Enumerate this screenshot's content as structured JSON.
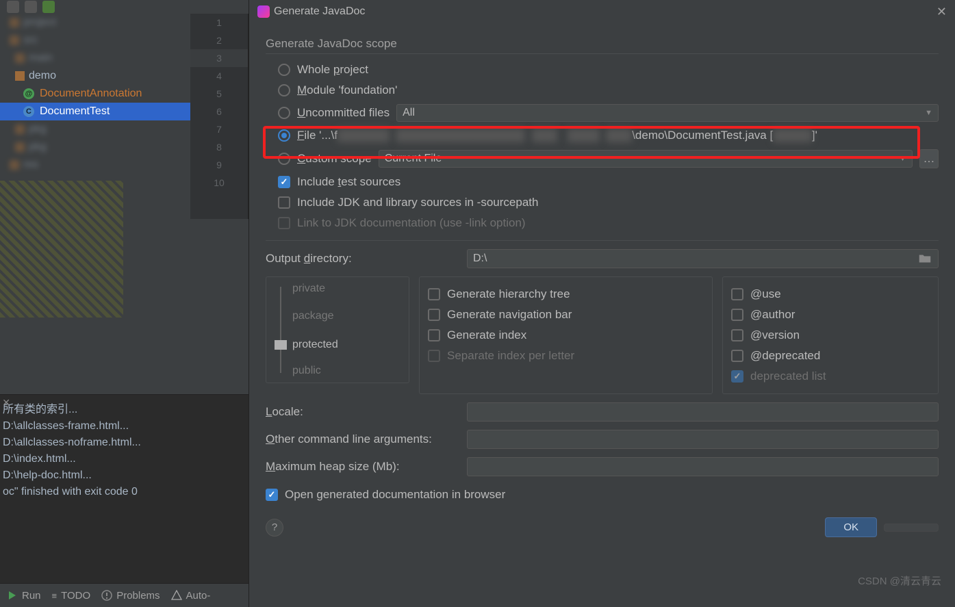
{
  "dialog": {
    "title": "Generate JavaDoc",
    "scope_title": "Generate JavaDoc scope",
    "radios": {
      "whole": "Whole project",
      "module": "Module 'foundation'",
      "uncommitted": "Uncommitted files",
      "file_prefix": "File '...\\f",
      "file_suffix": "\\demo\\DocumentTest.java [",
      "file_tail": "]'",
      "custom": "Custom scope"
    },
    "combos": {
      "uncommitted_value": "All",
      "custom_value": "Current File"
    },
    "checks": {
      "include_tests": "Include test sources",
      "include_jdk": "Include JDK and library sources in -sourcepath",
      "link_jdk": "Link to JDK documentation (use -link option)",
      "open_browser": "Open generated documentation in browser"
    },
    "output_directory_label": "Output directory:",
    "output_directory_value": "D:\\",
    "visibility": {
      "private": "private",
      "package": "package",
      "protected": "protected",
      "public": "public"
    },
    "gen_opts": {
      "tree": "Generate hierarchy tree",
      "nav": "Generate navigation bar",
      "index": "Generate index",
      "sep_index": "Separate index per letter"
    },
    "tag_opts": {
      "use": "@use",
      "author": "@author",
      "version": "@version",
      "deprecated": "@deprecated",
      "deplist": "deprecated list"
    },
    "locale_label": "Locale:",
    "other_args_label": "Other command line arguments:",
    "heap_label": "Maximum heap size (Mb):",
    "ok": "OK"
  },
  "tree": {
    "node_demo": "demo",
    "node_ann": "DocumentAnnotation",
    "node_test": "DocumentTest"
  },
  "gutter_lines": [
    "1",
    "2",
    "3",
    "4",
    "5",
    "6",
    "7",
    "8",
    "9",
    "10"
  ],
  "terminal": {
    "l0": "所有类的索引...",
    "l1": "D:\\allclasses-frame.html...",
    "l2": "D:\\allclasses-noframe.html...",
    "l3": "D:\\index.html...",
    "l4": "D:\\help-doc.html...",
    "l5": "",
    "l6": "oc\" finished with exit code 0"
  },
  "status": {
    "run": "Run",
    "todo": "TODO",
    "problems": "Problems",
    "auto": "Auto-"
  },
  "watermark": "CSDN @清云青云"
}
